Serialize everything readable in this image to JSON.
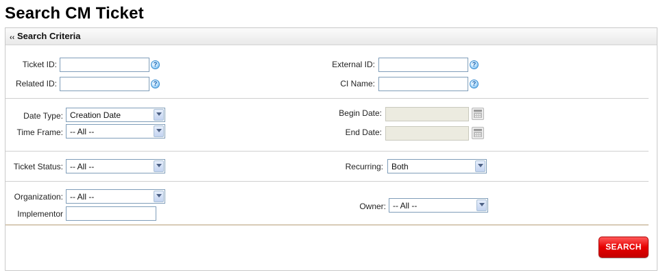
{
  "page": {
    "title": "Search CM Ticket"
  },
  "panel": {
    "collapse_icon": "‹‹",
    "title": "Search Criteria"
  },
  "fields": {
    "ticket_id": {
      "label": "Ticket ID:",
      "value": ""
    },
    "related_id": {
      "label": "Related ID:",
      "value": ""
    },
    "external_id": {
      "label": "External ID:",
      "value": ""
    },
    "ci_name": {
      "label": "CI Name:",
      "value": ""
    },
    "date_type": {
      "label": "Date Type:",
      "selected": "Creation Date"
    },
    "time_frame": {
      "label": "Time Frame:",
      "selected": "-- All --"
    },
    "begin_date": {
      "label": "Begin Date:",
      "value": ""
    },
    "end_date": {
      "label": "End Date:",
      "value": ""
    },
    "ticket_status": {
      "label": "Ticket Status:",
      "selected": "-- All --"
    },
    "recurring": {
      "label": "Recurring:",
      "selected": "Both"
    },
    "organization": {
      "label": "Organization:",
      "selected": "-- All --"
    },
    "implementor": {
      "label": "Implementor",
      "value": ""
    },
    "owner": {
      "label": "Owner:",
      "selected": "-- All --"
    }
  },
  "icons": {
    "help": "help-icon",
    "calendar": "calendar-icon",
    "dropdown": "chevron-down-icon"
  },
  "help_glyph": "?",
  "actions": {
    "search_label": "SEARCH"
  },
  "colors": {
    "search_button": "#e60000",
    "input_border": "#7f9db9",
    "disabled_date": "#ecebe0"
  }
}
